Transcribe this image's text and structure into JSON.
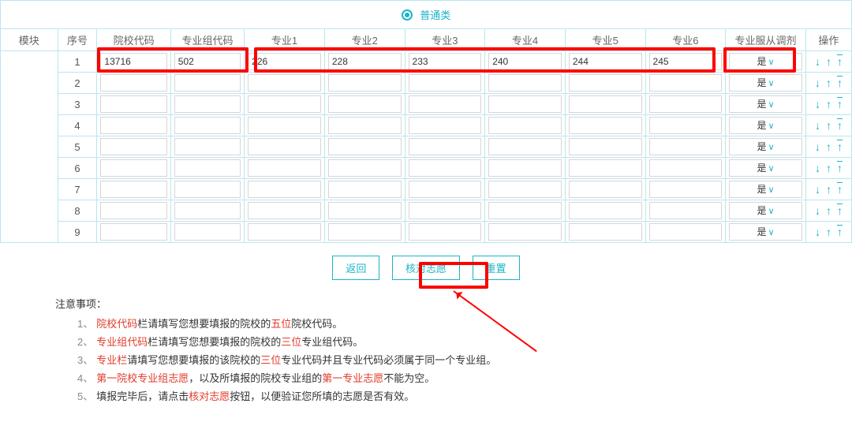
{
  "tab": {
    "label": "普通类"
  },
  "headers": {
    "module": "模块",
    "index": "序号",
    "school_code": "院校代码",
    "group_code": "专业组代码",
    "major1": "专业1",
    "major2": "专业2",
    "major3": "专业3",
    "major4": "专业4",
    "major5": "专业5",
    "major6": "专业6",
    "obey": "专业服从调剂",
    "ops": "操作"
  },
  "rows": [
    {
      "idx": "1",
      "school": "13716",
      "group": "502",
      "m1": "226",
      "m2": "228",
      "m3": "233",
      "m4": "240",
      "m5": "244",
      "m6": "245",
      "obey": "是"
    },
    {
      "idx": "2",
      "school": "",
      "group": "",
      "m1": "",
      "m2": "",
      "m3": "",
      "m4": "",
      "m5": "",
      "m6": "",
      "obey": "是"
    },
    {
      "idx": "3",
      "school": "",
      "group": "",
      "m1": "",
      "m2": "",
      "m3": "",
      "m4": "",
      "m5": "",
      "m6": "",
      "obey": "是"
    },
    {
      "idx": "4",
      "school": "",
      "group": "",
      "m1": "",
      "m2": "",
      "m3": "",
      "m4": "",
      "m5": "",
      "m6": "",
      "obey": "是"
    },
    {
      "idx": "5",
      "school": "",
      "group": "",
      "m1": "",
      "m2": "",
      "m3": "",
      "m4": "",
      "m5": "",
      "m6": "",
      "obey": "是"
    },
    {
      "idx": "6",
      "school": "",
      "group": "",
      "m1": "",
      "m2": "",
      "m3": "",
      "m4": "",
      "m5": "",
      "m6": "",
      "obey": "是"
    },
    {
      "idx": "7",
      "school": "",
      "group": "",
      "m1": "",
      "m2": "",
      "m3": "",
      "m4": "",
      "m5": "",
      "m6": "",
      "obey": "是"
    },
    {
      "idx": "8",
      "school": "",
      "group": "",
      "m1": "",
      "m2": "",
      "m3": "",
      "m4": "",
      "m5": "",
      "m6": "",
      "obey": "是"
    },
    {
      "idx": "9",
      "school": "",
      "group": "",
      "m1": "",
      "m2": "",
      "m3": "",
      "m4": "",
      "m5": "",
      "m6": "",
      "obey": "是"
    }
  ],
  "buttons": {
    "back": "返回",
    "verify": "核对志愿",
    "reset": "重置"
  },
  "notes": {
    "title": "注意事项：",
    "items": [
      {
        "idx": "1、",
        "parts": [
          "",
          "院校代码",
          "栏请填写您想要填报的院校的",
          "五位",
          "院校代码。"
        ]
      },
      {
        "idx": "2、",
        "parts": [
          "",
          "专业组代码",
          "栏请填写您想要填报的院校的",
          "三位",
          "专业组代码。"
        ]
      },
      {
        "idx": "3、",
        "parts": [
          "",
          "专业栏",
          "请填写您想要填报的该院校的",
          "三位",
          "专业代码并且专业代码必须属于同一个专业组。"
        ]
      },
      {
        "idx": "4、",
        "parts": [
          "",
          "第一院校专业组志愿",
          "，以及所填报的院校专业组的",
          "第一专业志愿",
          "不能为空。"
        ]
      },
      {
        "idx": "5、",
        "parts": [
          "填报完毕后，请点击",
          "核对志愿",
          "按钮，以便验证您所填的志愿是否有效。",
          "",
          ""
        ]
      }
    ]
  }
}
